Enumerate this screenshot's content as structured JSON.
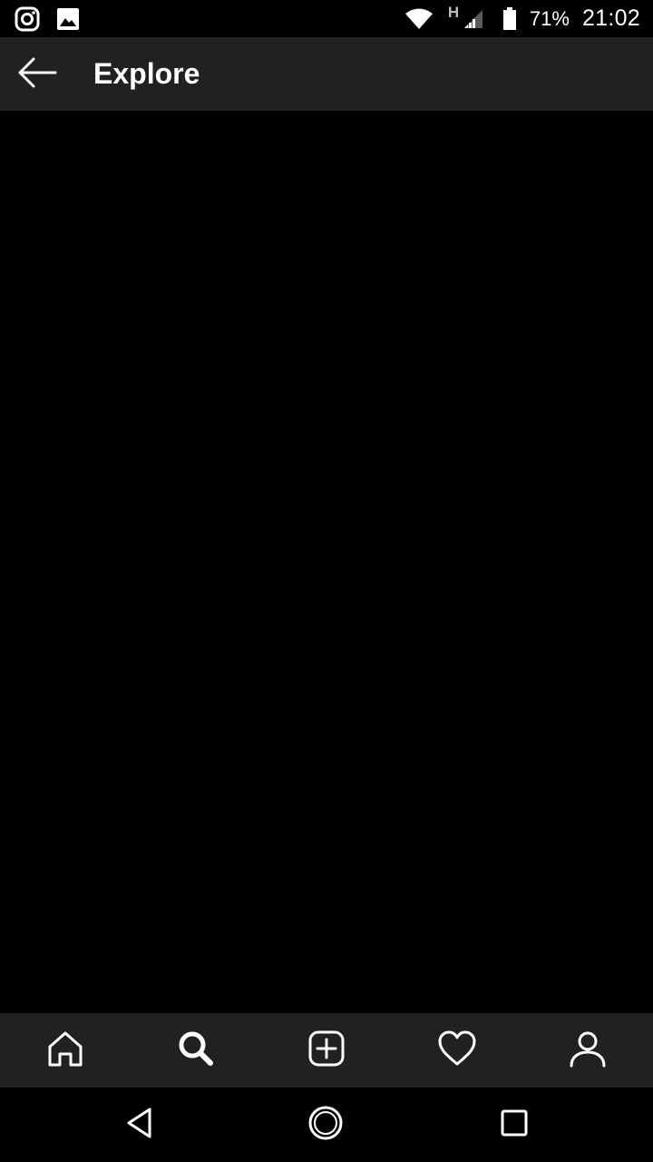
{
  "status_bar": {
    "left_icons": [
      "instagram-icon",
      "image-icon"
    ],
    "right_icons": [
      "wifi-icon",
      "hspa-icon",
      "signal-icon",
      "battery-icon"
    ],
    "network_type": "H",
    "battery": "71%",
    "time": "21:02"
  },
  "app_bar": {
    "title": "Explore",
    "back_icon": "arrow-left-icon"
  },
  "bottom_nav": {
    "items": [
      {
        "icon": "home-icon"
      },
      {
        "icon": "search-icon"
      },
      {
        "icon": "add-post-icon"
      },
      {
        "icon": "heart-icon"
      },
      {
        "icon": "profile-icon"
      }
    ]
  },
  "system_nav": {
    "items": [
      {
        "icon": "back-triangle-icon"
      },
      {
        "icon": "home-circle-icon"
      },
      {
        "icon": "recents-square-icon"
      }
    ]
  },
  "colors": {
    "background": "#000000",
    "bar_background": "#212121",
    "foreground": "#ffffff"
  }
}
